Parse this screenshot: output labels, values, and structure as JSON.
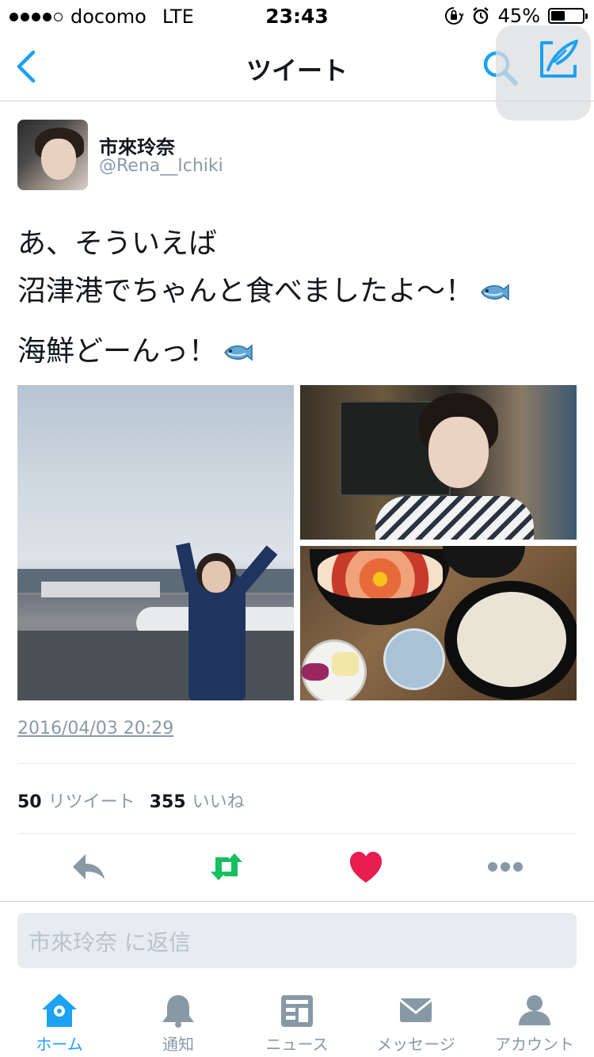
{
  "status_bar": {
    "carrier": "docomo",
    "network": "LTE",
    "time": "23:43",
    "battery": "45%",
    "battery_level": 0.45
  },
  "nav": {
    "title": "ツイート"
  },
  "tweet": {
    "display_name": "市來玲奈",
    "username": "@Rena__Ichiki",
    "text_lines": [
      "あ、そういえば",
      "沼津港でちゃんと食べましたよ〜！",
      "海鮮どーんっ！"
    ],
    "timestamp": "2016/04/03 20:29",
    "retweet_count": "50",
    "retweet_label": "リツイート",
    "like_count": "355",
    "like_label": "いいね"
  },
  "reply": {
    "placeholder": "市來玲奈 に返信"
  },
  "tabs": [
    {
      "label": "ホーム",
      "icon": "home-icon",
      "active": true
    },
    {
      "label": "通知",
      "icon": "bell-icon",
      "active": false
    },
    {
      "label": "ニュース",
      "icon": "news-icon",
      "active": false
    },
    {
      "label": "メッセージ",
      "icon": "envelope-icon",
      "active": false
    },
    {
      "label": "アカウント",
      "icon": "person-icon",
      "active": false
    }
  ],
  "colors": {
    "accent": "#1da1f2",
    "retweet_green": "#17bf63",
    "like_red": "#e81c4f",
    "muted": "#8899a6"
  }
}
